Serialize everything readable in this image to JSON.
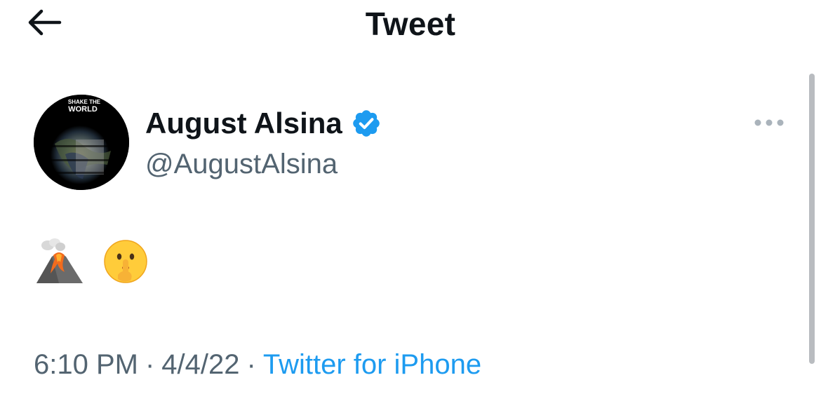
{
  "header": {
    "title": "Tweet"
  },
  "author": {
    "avatar_text_top": "SHAKE THE",
    "avatar_text_bottom": "WORLD",
    "display_name": "August Alsina",
    "handle": "@AugustAlsina",
    "verified": true
  },
  "tweet": {
    "emojis": [
      "volcano",
      "shushing-face"
    ]
  },
  "meta": {
    "time": "6:10 PM",
    "separator": "·",
    "date": "4/4/22",
    "source": "Twitter for iPhone"
  },
  "colors": {
    "primary_text": "#0f1419",
    "secondary_text": "#536471",
    "accent": "#1d9bf0",
    "scrollbar": "#b9bcc0"
  },
  "icons": [
    "back-arrow-icon",
    "verified-badge-icon",
    "more-options-icon",
    "volcano-emoji-icon",
    "shushing-face-emoji-icon"
  ]
}
